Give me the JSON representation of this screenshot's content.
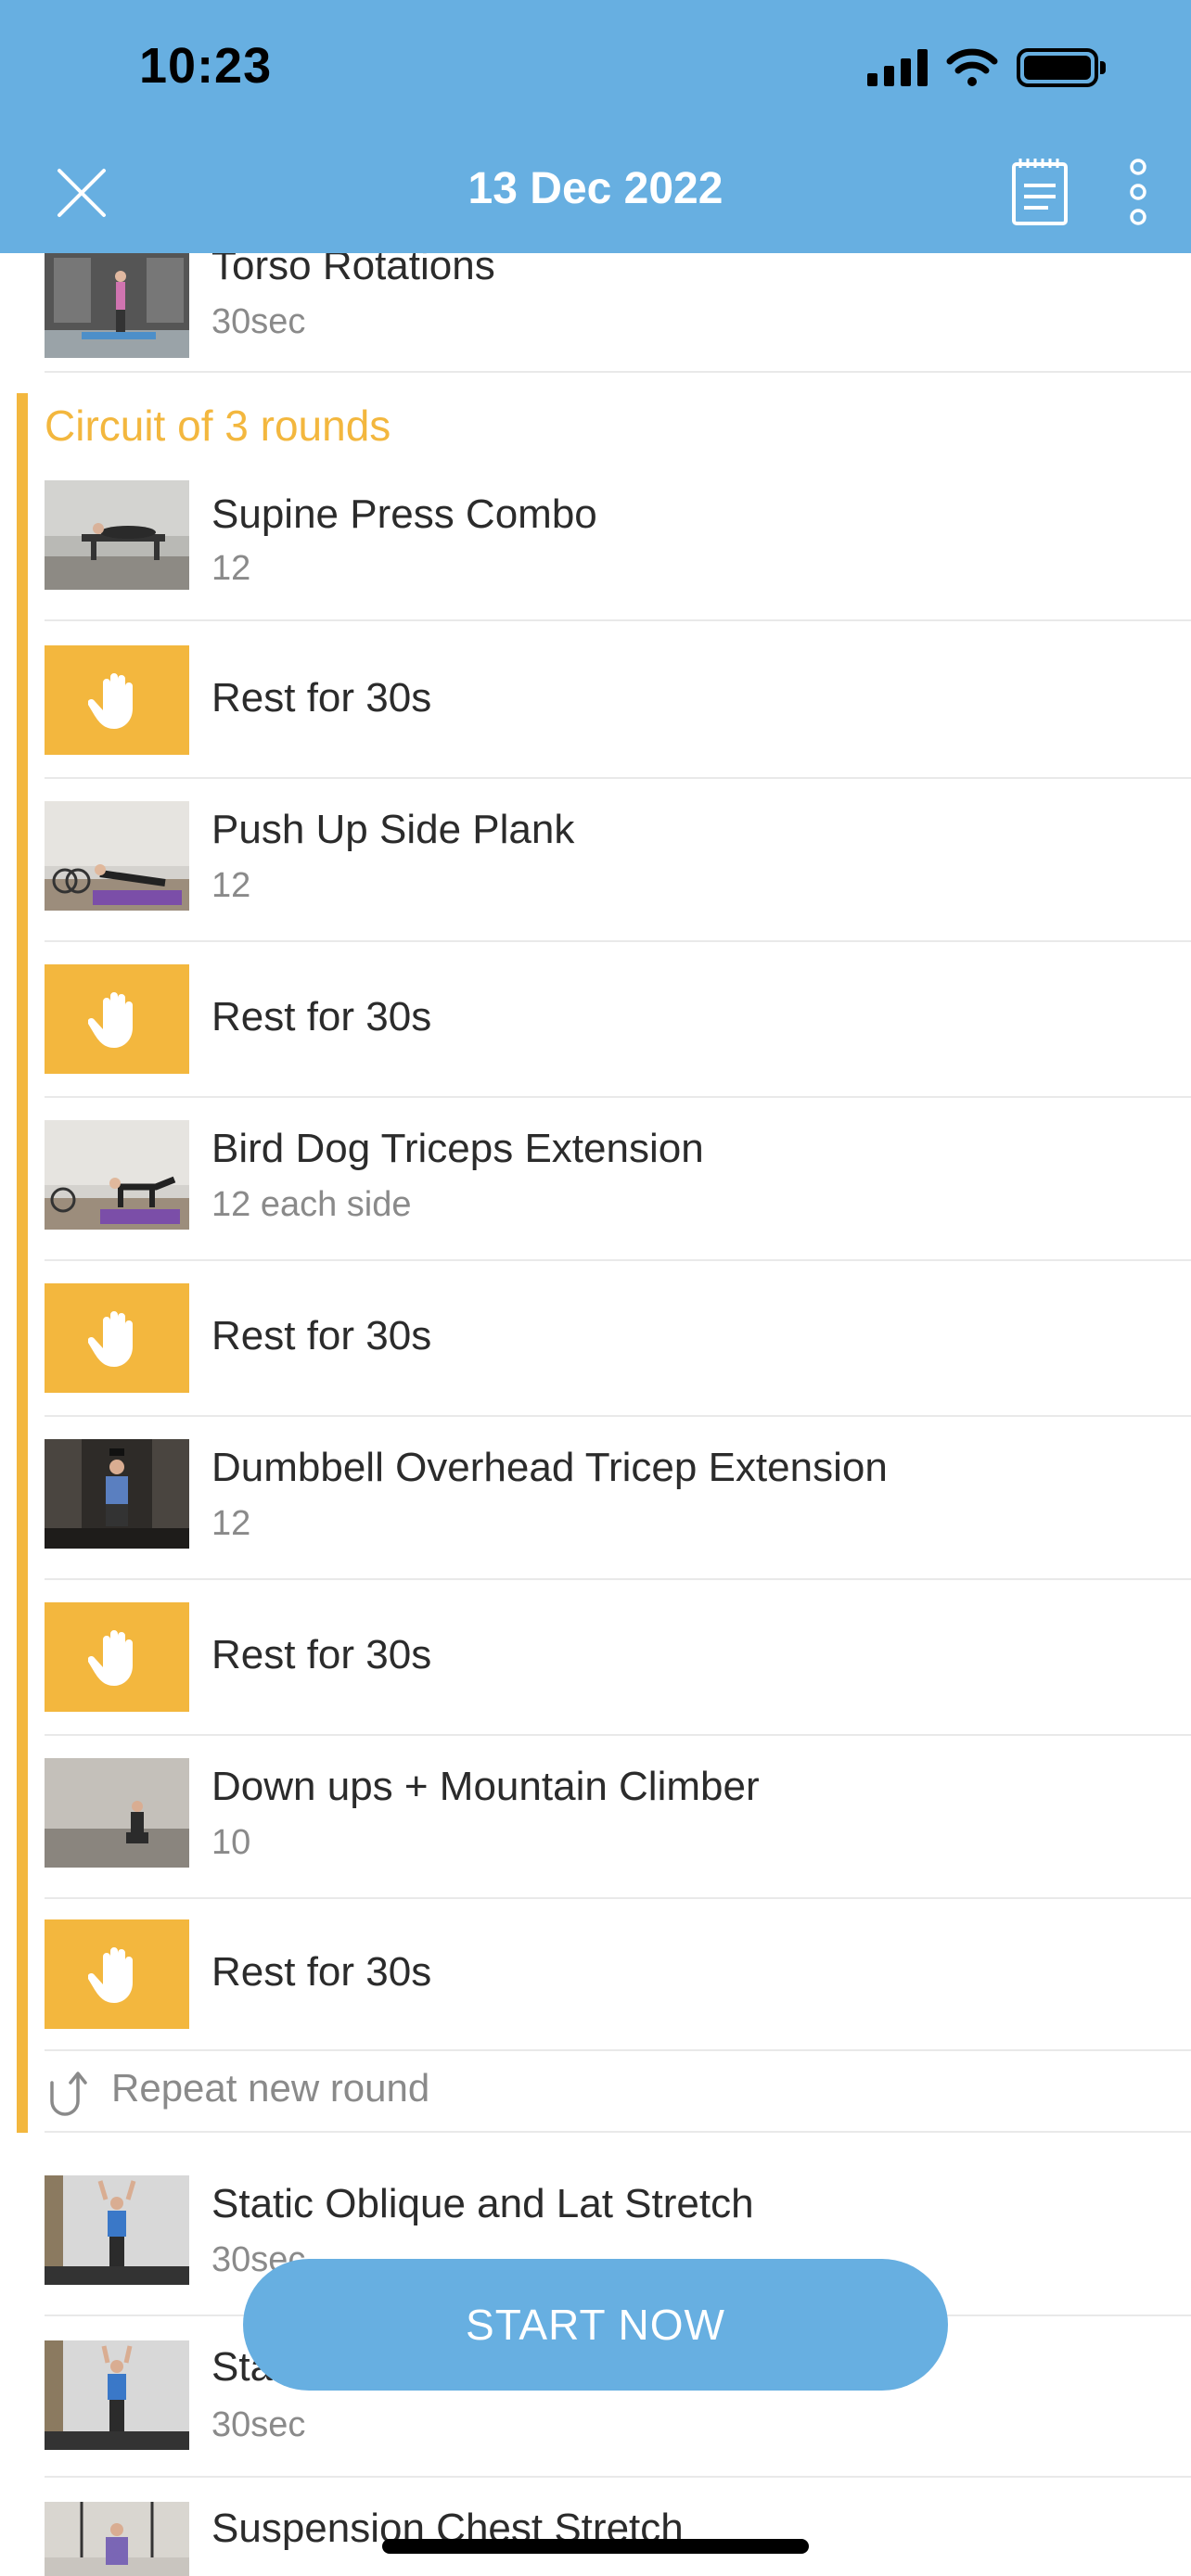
{
  "status_bar": {
    "time": "10:23"
  },
  "nav": {
    "title": "13 Dec 2022",
    "close_icon": "close-icon",
    "notes_icon": "notepad-icon",
    "more_icon": "more-vertical-icon"
  },
  "colors": {
    "header_bg": "#67afe1",
    "accent": "#f3b73e",
    "button_bg": "#67afe1"
  },
  "top_exercise": {
    "name": "Torso Rotations",
    "detail": "30sec"
  },
  "circuit": {
    "title": "Circuit of 3 rounds",
    "items": [
      {
        "type": "exercise",
        "name": "Supine Press Combo",
        "detail": "12"
      },
      {
        "type": "rest",
        "name": "Rest for 30s"
      },
      {
        "type": "exercise",
        "name": "Push Up Side Plank",
        "detail": "12"
      },
      {
        "type": "rest",
        "name": "Rest for 30s"
      },
      {
        "type": "exercise",
        "name": "Bird Dog Triceps Extension",
        "detail": "12 each side"
      },
      {
        "type": "rest",
        "name": "Rest for 30s"
      },
      {
        "type": "exercise",
        "name": "Dumbbell Overhead Tricep Extension",
        "detail": "12"
      },
      {
        "type": "rest",
        "name": "Rest for 30s"
      },
      {
        "type": "exercise",
        "name": "Down ups + Mountain Climber",
        "detail": "10"
      },
      {
        "type": "rest",
        "name": "Rest for 30s"
      }
    ],
    "repeat_label": "Repeat new round"
  },
  "after_circuit": [
    {
      "name": "Static Oblique and Lat Stretch",
      "detail": "30sec"
    },
    {
      "name": "Sta",
      "detail": "30sec"
    },
    {
      "name": "Suspension Chest Stretch",
      "detail": ""
    }
  ],
  "start_button": {
    "label": "START NOW"
  }
}
